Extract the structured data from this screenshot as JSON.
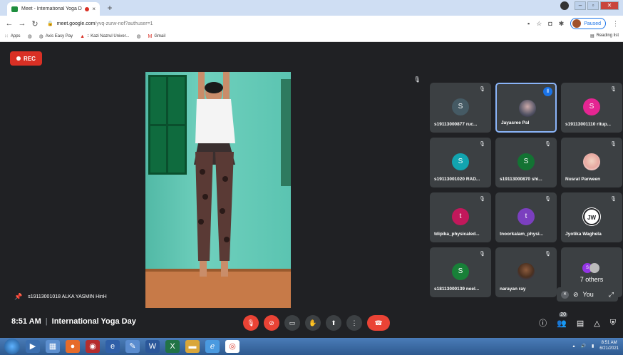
{
  "browser": {
    "tab_title": "Meet - International Yoga D",
    "tab_close": "×",
    "new_tab": "+",
    "url_host": "meet.google.com",
    "url_path": "/yvq-zurw-nof?authuser=1",
    "profile_status": "Paused",
    "bookmarks": [
      {
        "label": "Apps",
        "icon": "apps-grid-icon"
      },
      {
        "label": "",
        "icon": "globe-icon"
      },
      {
        "label": "Axis Easy Pay",
        "icon": "globe-icon"
      },
      {
        "label": ":: Kazi Nazrul Univer...",
        "icon": "university-icon"
      },
      {
        "label": "",
        "icon": "globe-icon"
      },
      {
        "label": "Gmail",
        "icon": "gmail-icon"
      }
    ],
    "reading_list": "Reading list"
  },
  "meet": {
    "rec_label": "REC",
    "main_participant": "s19113001018 ALKA YASMIN HinH",
    "time": "8:51 AM",
    "separator": "|",
    "meeting_title": "International Yoga Day",
    "participants": [
      {
        "name": "s19113000877 ruc...",
        "initial": "S",
        "color": "#455a64",
        "muted": true
      },
      {
        "name": "Jayasree Pal",
        "initial": "",
        "color": "",
        "muted": false,
        "speaking": true,
        "photo": "photo"
      },
      {
        "name": "s19113001110 ritup...",
        "initial": "S",
        "color": "#e52592",
        "muted": true
      },
      {
        "name": "s19113001020 RAD...",
        "initial": "S",
        "color": "#12a4af",
        "muted": true
      },
      {
        "name": "s19113000870 shi...",
        "initial": "S",
        "color": "#137333",
        "muted": true
      },
      {
        "name": "Nusrat Parween",
        "initial": "",
        "color": "",
        "muted": true,
        "photo": "photo2"
      },
      {
        "name": "tdipika_physicaled...",
        "initial": "t",
        "color": "#c2185b",
        "muted": true
      },
      {
        "name": "tnoorkalam_physi...",
        "initial": "t",
        "color": "#7b3fbf",
        "muted": true
      },
      {
        "name": "Jyotika Waghela",
        "initial": "JW",
        "color": "#ffffff",
        "muted": true,
        "photo": "jw"
      },
      {
        "name": "s18113000139 neel...",
        "initial": "S",
        "color": "#188038",
        "muted": true
      },
      {
        "name": "narayan ray",
        "initial": "",
        "color": "",
        "muted": true,
        "photo": "photo3"
      }
    ],
    "others_label": "7 others",
    "others_initial": "S",
    "you_label": "You",
    "people_count": "20"
  },
  "taskbar": {
    "clock_time": "8:51 AM",
    "clock_date": "6/21/2021"
  }
}
